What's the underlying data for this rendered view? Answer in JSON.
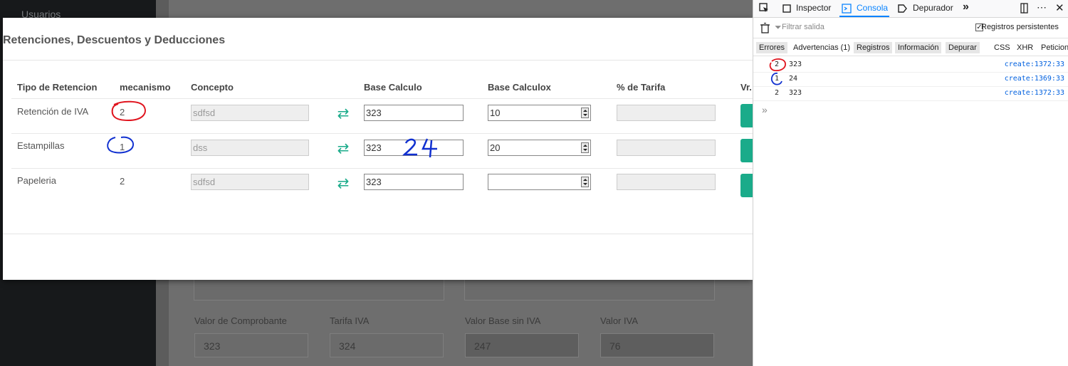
{
  "sidebar": {
    "users_label": "Usuarios"
  },
  "modal": {
    "title": "Retenciones, Descuentos y Deducciones",
    "headers": [
      "Tipo de Retencion",
      "mecanismo",
      "Concepto",
      "Base Calculo",
      "Base Calculox",
      "% de Tarifa",
      "Vr."
    ],
    "rows": [
      {
        "tipo": "Retención de IVA",
        "mecanismo": "2",
        "concepto": "sdfsd",
        "base_calculo": "323",
        "base_calculox": "10",
        "tarifa": ""
      },
      {
        "tipo": "Estampillas",
        "mecanismo": "1",
        "concepto": "dss",
        "base_calculo": "323",
        "base_calculox": "20",
        "tarifa": ""
      },
      {
        "tipo": "Papeleria",
        "mecanismo": "2",
        "concepto": "sdfsd",
        "base_calculo": "323",
        "base_calculox": "",
        "tarifa": ""
      }
    ],
    "swap_icon": "exchange-arrows-icon",
    "annotations": {
      "handwritten_24": "24"
    }
  },
  "background_form": {
    "labels": [
      "Valor de Comprobante",
      "Tarifa IVA",
      "Valor Base sin IVA",
      "Valor IVA"
    ],
    "values": [
      "323",
      "324",
      "247",
      "76"
    ]
  },
  "devtools": {
    "tabs": [
      "Inspector",
      "Consola",
      "Depurador"
    ],
    "active_tab": "Consola",
    "filter_placeholder": "Filtrar salida",
    "persist_label": "Registros persistentes",
    "categories": [
      "Errores",
      "Advertencias (1)",
      "Registros",
      "Información",
      "Depurar",
      "CSS",
      "XHR",
      "Peticiones"
    ],
    "logs": [
      {
        "count": "2",
        "value": "323",
        "source": "create:1372:33"
      },
      {
        "count": "1",
        "value": "24",
        "source": "create:1369:33"
      },
      {
        "count": "2",
        "value": "323",
        "source": "create:1372:33"
      }
    ],
    "prompt": "»",
    "colors": {
      "accent": "#0a84ff",
      "link": "#0060df"
    }
  },
  "colors": {
    "green": "#1aab8a",
    "annotation_red": "#e0141e",
    "annotation_blue": "#1030d0"
  }
}
